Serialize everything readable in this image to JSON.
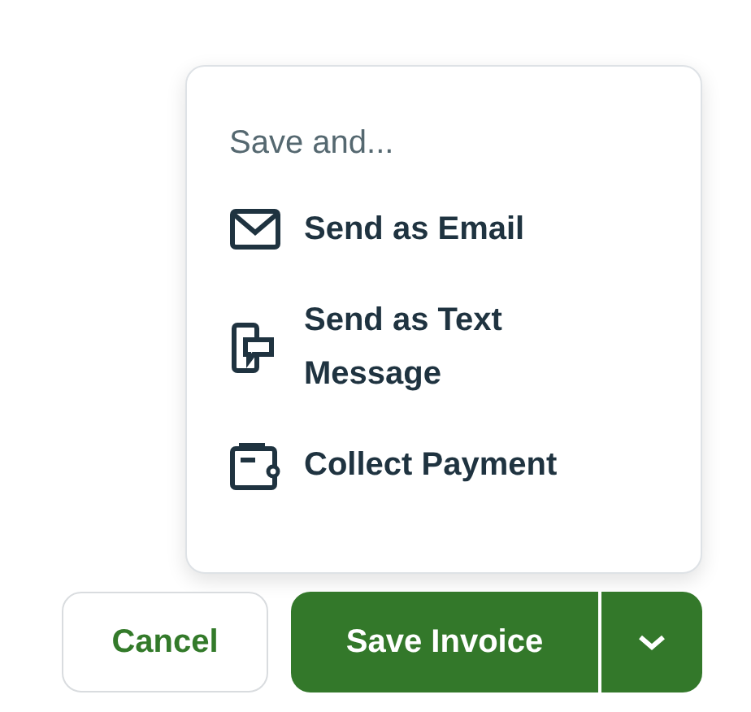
{
  "menu": {
    "header": "Save and...",
    "items": [
      {
        "kind": "email",
        "label": "Send as Email"
      },
      {
        "kind": "text",
        "label": "Send as Text Message"
      },
      {
        "kind": "payment",
        "label": "Collect Payment"
      }
    ]
  },
  "buttons": {
    "cancel": "Cancel",
    "save": "Save Invoice",
    "menu_expanded": true
  }
}
